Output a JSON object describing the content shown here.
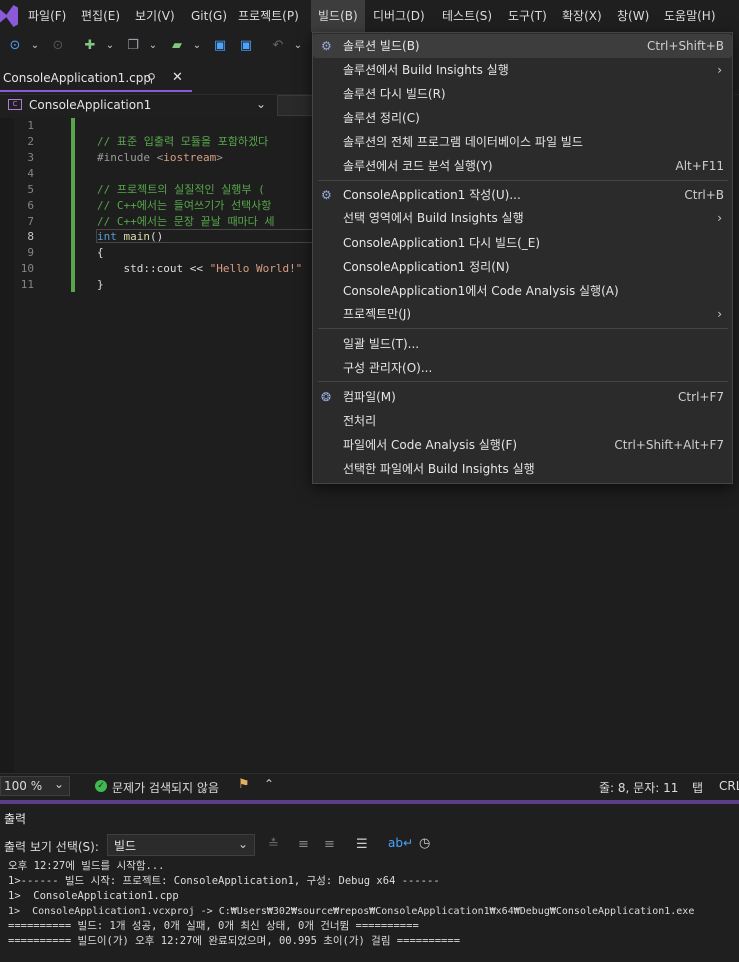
{
  "menubar": {
    "items": [
      "파일(F)",
      "편집(E)",
      "보기(V)",
      "Git(G)",
      "프로젝트(P)",
      "빌드(B)",
      "디버그(D)",
      "테스트(S)",
      "도구(T)",
      "확장(X)",
      "창(W)",
      "도움말(H)"
    ],
    "active": "빌드(B)"
  },
  "tab": {
    "filename": "ConsoleApplication1.cpp",
    "pin": "⊿",
    "close": "✕"
  },
  "nav": {
    "project": "ConsoleApplication1"
  },
  "editor": {
    "line_numbers": [
      "1",
      "2",
      "3",
      "4",
      "5",
      "6",
      "7",
      "8",
      "9",
      "10",
      "11"
    ],
    "current_line": 8,
    "lines": [
      "",
      "// 표준 입출력 모듈을 포함하겠다",
      "#include <iostream>",
      "",
      "// 프로젝트의 실질적인 실행부 (",
      "// C++에서는 들여쓰기가 선택사항",
      "// C++에서는 문장 끝날 때마다 세",
      "int main()",
      "{",
      "    std::cout << \"Hello World!\"",
      "}"
    ]
  },
  "build_menu": {
    "items": [
      {
        "label": "솔루션 빌드(B)",
        "shortcut": "Ctrl+Shift+B",
        "icon": "build-icon",
        "highlighted": true
      },
      {
        "label": "솔루션에서 Build Insights 실행",
        "submenu": true
      },
      {
        "label": "솔루션 다시 빌드(R)"
      },
      {
        "label": "솔루션 정리(C)"
      },
      {
        "label": "솔루션의 전체 프로그램 데이터베이스 파일 빌드"
      },
      {
        "label": "솔루션에서 코드 분석 실행(Y)",
        "shortcut": "Alt+F11"
      },
      {
        "label": "ConsoleApplication1 작성(U)...",
        "shortcut": "Ctrl+B",
        "icon": "build-project-icon"
      },
      {
        "label": "선택 영역에서 Build Insights 실행",
        "submenu": true
      },
      {
        "label": "ConsoleApplication1 다시 빌드(_E)"
      },
      {
        "label": "ConsoleApplication1 정리(N)"
      },
      {
        "label": "ConsoleApplication1에서 Code Analysis 실행(A)"
      },
      {
        "label": "프로젝트만(J)",
        "submenu": true
      },
      {
        "label": "일괄 빌드(T)..."
      },
      {
        "label": "구성 관리자(O)..."
      },
      {
        "label": "컴파일(M)",
        "shortcut": "Ctrl+F7",
        "icon": "compile-icon"
      },
      {
        "label": "전처리"
      },
      {
        "label": "파일에서 Code Analysis 실행(F)",
        "shortcut": "Ctrl+Shift+Alt+F7"
      },
      {
        "label": "선택한 파일에서 Build Insights 실행"
      }
    ]
  },
  "status": {
    "zoom": "100 %",
    "issues": "문제가 검색되지 않음",
    "position": "줄: 8, 문자: 11",
    "tab_mode": "탭",
    "line_ending": "CRL"
  },
  "output": {
    "title": "출력",
    "source_label": "출력 보기 선택(S):",
    "source_value": "빌드",
    "lines": [
      "오후 12:27에 빌드를 시작함...",
      "1>------ 빌드 시작: 프로젝트: ConsoleApplication1, 구성: Debug x64 ------",
      "1>  ConsoleApplication1.cpp",
      "1>  ConsoleApplication1.vcxproj -> C:₩Users₩302₩source₩repos₩ConsoleApplication1₩x64₩Debug₩ConsoleApplication1.exe",
      "========== 빌드: 1개 성공, 0개 실패, 0개 최신 상태, 0개 건너뜀 ==========",
      "========== 빌드이(가) 오후 12:27에 완료되었으며, 00.995 초이(가) 걸림 =========="
    ]
  }
}
